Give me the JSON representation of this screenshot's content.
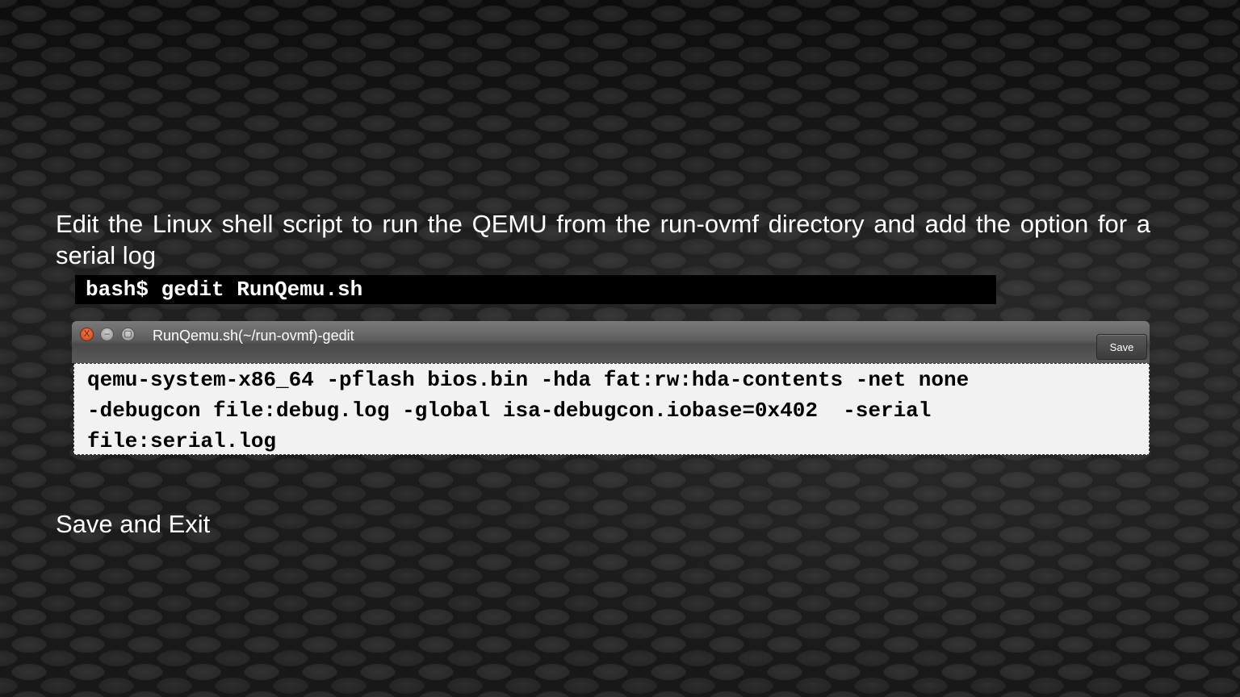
{
  "instruction": {
    "text": "Edit  the Linux shell script to run the QEMU from the run-ovmf directory and add  the option for a serial log"
  },
  "terminal": {
    "command": "bash$ gedit RunQemu.sh"
  },
  "gedit": {
    "title": "RunQemu.sh(~/run-ovmf)-gedit",
    "save_label": "Save",
    "close_glyph": "X",
    "min_glyph": "–",
    "max_glyph": "▢",
    "content_lines": [
      "qemu-system-x86_64 -pflash bios.bin -hda fat:rw:hda-contents -net none",
      "-debugcon file:debug.log -global isa-debugcon.iobase=0x402  -serial",
      "file:serial.log"
    ]
  },
  "outro": {
    "text": "Save and Exit"
  }
}
